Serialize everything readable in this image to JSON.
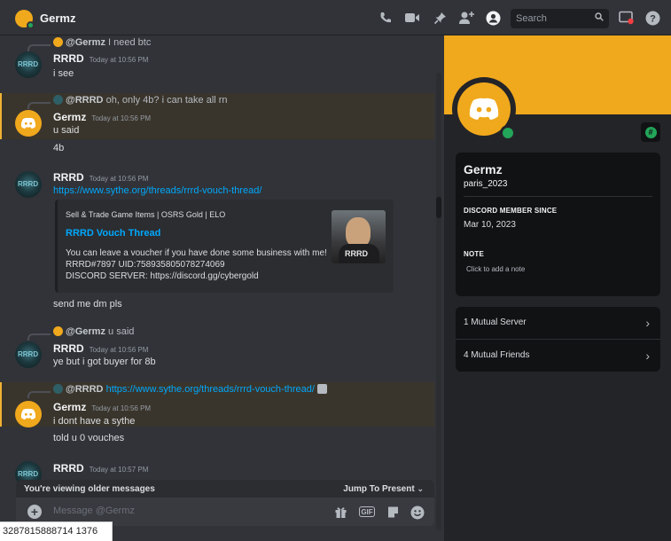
{
  "header": {
    "title": "Germz",
    "search_placeholder": "Search",
    "icons": [
      "call-icon",
      "video-icon",
      "pin-icon",
      "add-member-icon",
      "profile-icon",
      "inbox-icon",
      "help-icon"
    ]
  },
  "messages": [
    {
      "reply_user": "@Germz",
      "reply_text": "I need btc"
    },
    {
      "user": "RRRD",
      "time": "Today at 10:56 PM",
      "text": "i see"
    },
    {
      "reply_user": "@RRRD",
      "reply_text": "oh, only 4b? i can take all rn",
      "user": "Germz",
      "time": "Today at 10:56 PM",
      "text": "u said",
      "text2": "4b"
    },
    {
      "user": "RRRD",
      "time": "Today at 10:56 PM",
      "link": "https://www.sythe.org/threads/rrrd-vouch-thread/"
    },
    {
      "text": "send me dm pls"
    },
    {
      "reply_user": "@Germz",
      "reply_text": "u said",
      "user": "RRRD",
      "time": "Today at 10:56 PM",
      "text": "ye but i got buyer for 8b"
    },
    {
      "reply_user": "@RRRD",
      "reply_link": "https://www.sythe.org/threads/rrrd-vouch-thread/",
      "user": "Germz",
      "time": "Today at 10:56 PM",
      "text": "i dont have a sythe",
      "text2": "told u 0 vouches"
    },
    {
      "user": "RRRD",
      "time": "Today at 10:57 PM"
    }
  ],
  "embed": {
    "provider": "Sell & Trade Game Items | OSRS Gold | ELO",
    "title": "RRRD Vouch Thread",
    "line1": "You can leave a voucher if you have done some business with me!",
    "line2": "RRRD#7897 UID:758935805078274069",
    "line3": "DISCORD SERVER: https://discord.gg/cybergold",
    "thumb_text": "RRRD"
  },
  "banner": {
    "left": "You're viewing older messages",
    "right": "Jump To Present"
  },
  "composer": {
    "placeholder": "Message @Germz"
  },
  "id_strip": "3287815888714 1376",
  "profile": {
    "name": "Germz",
    "username": "paris_2023",
    "member_since_label": "DISCORD MEMBER SINCE",
    "member_since": "Mar 10, 2023",
    "note_label": "NOTE",
    "note_placeholder": "Click to add a note",
    "mutual_servers": "1 Mutual Server",
    "mutual_friends": "4 Mutual Friends"
  },
  "colors": {
    "accent": "#f0a81c",
    "online": "#23a55a",
    "link": "#00a8fc",
    "highlight": "#3a352c"
  }
}
